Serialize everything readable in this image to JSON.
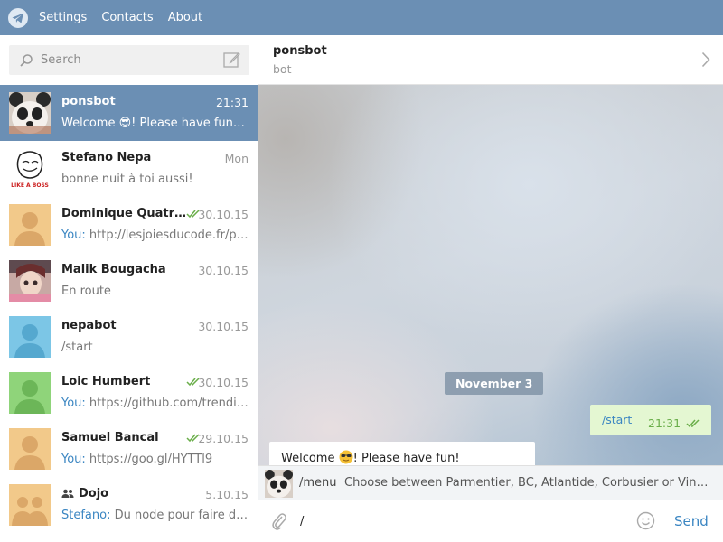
{
  "topbar": {
    "menu": [
      "Settings",
      "Contacts",
      "About"
    ]
  },
  "search": {
    "placeholder": "Search"
  },
  "dialogs": [
    {
      "name": "ponsbot",
      "time": "21:31",
      "snippet": "Welcome 😎! Please have fun! A...",
      "active": true,
      "avatar": "panda"
    },
    {
      "name": "Stefano Nepa",
      "time": "Mon",
      "snippet": "bonne nuit à toi aussi!",
      "avatar": "meme"
    },
    {
      "name": "Dominique Quatra...",
      "time": "30.10.15",
      "you": "You:",
      "snippet": " http://lesjoiesducode.fr/po...",
      "read": true,
      "avatar": "orange"
    },
    {
      "name": "Malik Bougacha",
      "time": "30.10.15",
      "snippet": "En route",
      "avatar": "photo"
    },
    {
      "name": "nepabot",
      "time": "30.10.15",
      "snippet": "/start",
      "avatar": "blue"
    },
    {
      "name": "Loic Humbert",
      "time": "30.10.15",
      "you": "You:",
      "snippet": " https://github.com/trending",
      "read": true,
      "avatar": "green"
    },
    {
      "name": "Samuel Bancal",
      "time": "29.10.15",
      "you": "You:",
      "snippet": " https://goo.gl/HYTTl9",
      "read": true,
      "avatar": "orange"
    },
    {
      "name": "Dojo",
      "time": "5.10.15",
      "you": "Stefano:",
      "snippet": " Du node pour faire des ...",
      "group": true,
      "avatar": "group"
    }
  ],
  "chat": {
    "peer_name": "ponsbot",
    "peer_status": "bot",
    "date_separator": "November 3",
    "outgoing": {
      "text": "/start",
      "time": "21:31"
    },
    "incoming": {
      "text_before": "Welcome ",
      "text_after": "! Please have fun!"
    }
  },
  "command": {
    "name": "/menu",
    "description": "Choose between Parmentier, BC, Atlantide, Corbusier or Vinci me..."
  },
  "composer": {
    "value": "/",
    "send_label": "Send"
  },
  "colors": {
    "header": "#6b8fb4",
    "accent": "#3b86c2",
    "outgoing_bubble": "#e4f7d2",
    "read_ticks": "#6aae4a"
  }
}
